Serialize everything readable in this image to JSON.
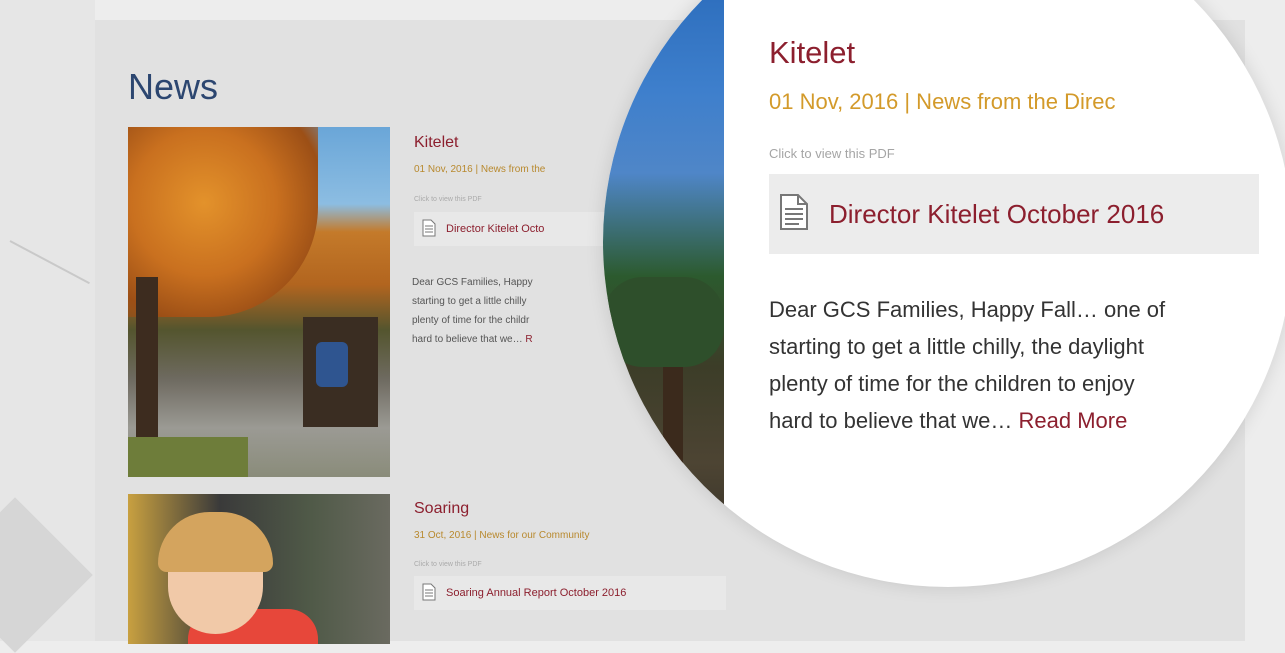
{
  "news": {
    "title": "News"
  },
  "articles": [
    {
      "title": "Kitelet",
      "meta_small": "01 Nov, 2016 | News from the",
      "pdf_note": "Click to view this PDF",
      "pdf_label_small": "Director Kitelet Octo",
      "excerpt_lines_small": [
        "Dear GCS Families, Happy",
        "starting to get a little chilly",
        "plenty of time for the childr",
        "hard to believe that we…"
      ],
      "read_more_small": "R"
    },
    {
      "title": "Soaring",
      "meta_small": "31 Oct, 2016 | News for our Community",
      "pdf_note": "Click to view this PDF",
      "pdf_label_small": "Soaring Annual Report October 2016"
    }
  ],
  "magnified": {
    "title": "Kitelet",
    "meta": "01 Nov, 2016 | News from the Direc",
    "pdf_note": "Click to view this PDF",
    "pdf_label": "Director Kitelet October 2016",
    "excerpt_lines": [
      "Dear GCS Families, Happy Fall… one of",
      "starting to get a little chilly, the daylight",
      "plenty of time for the children to enjoy",
      "hard to believe that we…"
    ],
    "read_more": "Read More"
  },
  "colors": {
    "title_blue": "#2c4670",
    "link_red": "#8c1f2e",
    "meta_gold": "#d39a2a"
  },
  "icons": {
    "pdf": "document-icon"
  }
}
